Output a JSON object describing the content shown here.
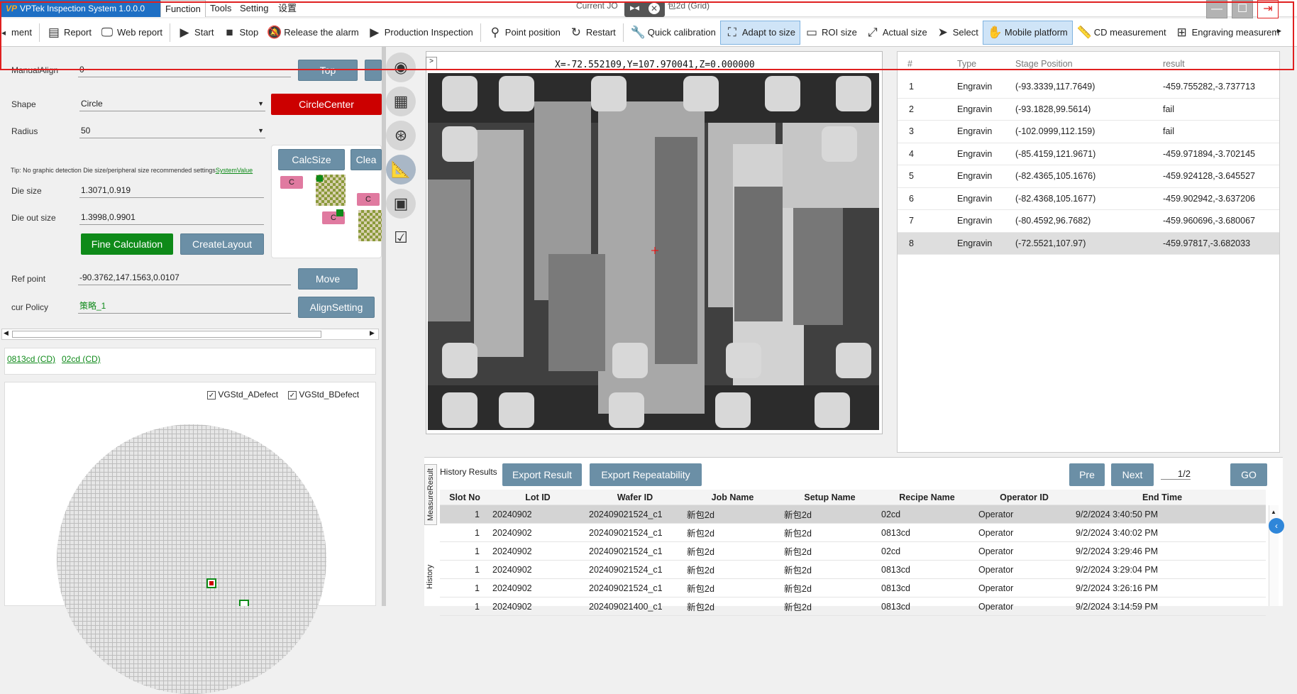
{
  "title_bar": {
    "app_title": "VPTek Inspection System 1.0.0.0",
    "logo": "VP",
    "menus": [
      "Function",
      "Tools",
      "Setting",
      "设置"
    ],
    "center_text_left": "Current JO",
    "center_text_right": "包2d (Grid)"
  },
  "toolbar": {
    "items": [
      {
        "label": "ment",
        "icon": "partial-icon"
      },
      {
        "label": "Report",
        "icon": "report-icon"
      },
      {
        "label": "Web report",
        "icon": "web-report-icon"
      },
      {
        "label": "Start",
        "icon": "play-icon"
      },
      {
        "label": "Stop",
        "icon": "stop-icon"
      },
      {
        "label": "Release the alarm",
        "icon": "bell-off-icon"
      },
      {
        "label": "Production Inspection",
        "icon": "play-outline-icon"
      },
      {
        "label": "Point position",
        "icon": "location-pin-icon"
      },
      {
        "label": "Restart",
        "icon": "restart-icon"
      },
      {
        "label": "Quick calibration",
        "icon": "wrench-icon"
      },
      {
        "label": "Adapt to size",
        "icon": "fit-size-icon"
      },
      {
        "label": "ROI size",
        "icon": "roi-icon"
      },
      {
        "label": "Actual size",
        "icon": "actual-size-icon"
      },
      {
        "label": "Select",
        "icon": "cursor-icon"
      },
      {
        "label": "Mobile platform",
        "icon": "hand-icon"
      },
      {
        "label": "CD measurement",
        "icon": "ruler-icon"
      },
      {
        "label": "Engraving measurem",
        "icon": "plus-box-icon"
      }
    ]
  },
  "left": {
    "manual_align_label": "ManualAlign",
    "manual_align_value": "0",
    "top_button": "Top",
    "shape_label": "Shape",
    "shape_value": "Circle",
    "circle_center_button": "CircleCenter",
    "radius_label": "Radius",
    "radius_value": "50",
    "calc_size_button": "CalcSize",
    "clear_button": "Clea",
    "tip_text": "Tip: No graphic detection Die size/peripheral size recommended settings",
    "tip_link": "SystemValue",
    "die_size_label": "Die size",
    "die_size_value": "1.3071,0.919",
    "die_out_size_label": "Die out size",
    "die_out_size_value": "1.3998,0.9901",
    "chip_label": "C",
    "fine_calc_button": "Fine Calculation",
    "create_layout_button": "CreateLayout",
    "ref_point_label": "Ref point",
    "ref_point_value": "-90.3762,147.1563,0.0107",
    "move_button": "Move",
    "cur_policy_label": "cur Policy",
    "cur_policy_value": "策略_1",
    "align_setting_button": "AlignSetting",
    "recipe_links": [
      "0813cd (CD)",
      "02cd (CD)"
    ],
    "defect_checks": [
      {
        "label": "VGStd_ADefect",
        "checked": true
      },
      {
        "label": "VGStd_BDefect",
        "checked": true
      }
    ]
  },
  "viewer": {
    "expand": ">",
    "coords": "X=-72.552109,Y=107.970041,Z=0.000000"
  },
  "results": {
    "columns": [
      "#",
      "Type",
      "Stage Position",
      "result"
    ],
    "rows": [
      [
        "1",
        "Engravin",
        "(-93.3339,117.7649)",
        "-459.755282,-3.737713"
      ],
      [
        "2",
        "Engravin",
        "(-93.1828,99.5614)",
        "fail"
      ],
      [
        "3",
        "Engravin",
        "(-102.0999,112.159)",
        "fail"
      ],
      [
        "4",
        "Engravin",
        "(-85.4159,121.9671)",
        "-459.971894,-3.702145"
      ],
      [
        "5",
        "Engravin",
        "(-82.4365,105.1676)",
        "-459.924128,-3.645527"
      ],
      [
        "6",
        "Engravin",
        "(-82.4368,105.1677)",
        "-459.902942,-3.637206"
      ],
      [
        "7",
        "Engravin",
        "(-80.4592,96.7682)",
        "-459.960696,-3.680067"
      ],
      [
        "8",
        "Engravin",
        "(-72.5521,107.97)",
        "-459.97817,-3.682033"
      ]
    ],
    "selected_row": 8
  },
  "history": {
    "title": "History Results",
    "export_result": "Export Result",
    "export_repeatability": "Export Repeatability",
    "pre": "Pre",
    "next": "Next",
    "page": "1/2",
    "go": "GO",
    "tabs": [
      "MeasureResult",
      "History"
    ],
    "columns": [
      "Slot No",
      "Lot ID",
      "Wafer ID",
      "Job Name",
      "Setup Name",
      "Recipe Name",
      "Operator ID",
      "End Time"
    ],
    "rows": [
      [
        "1",
        "20240902",
        "202409021524_c1",
        "新包2d",
        "新包2d",
        "02cd",
        "Operator",
        "9/2/2024 3:40:50 PM"
      ],
      [
        "1",
        "20240902",
        "202409021524_c1",
        "新包2d",
        "新包2d",
        "0813cd",
        "Operator",
        "9/2/2024 3:40:02 PM"
      ],
      [
        "1",
        "20240902",
        "202409021524_c1",
        "新包2d",
        "新包2d",
        "02cd",
        "Operator",
        "9/2/2024 3:29:46 PM"
      ],
      [
        "1",
        "20240902",
        "202409021524_c1",
        "新包2d",
        "新包2d",
        "0813cd",
        "Operator",
        "9/2/2024 3:29:04 PM"
      ],
      [
        "1",
        "20240902",
        "202409021524_c1",
        "新包2d",
        "新包2d",
        "0813cd",
        "Operator",
        "9/2/2024 3:26:16 PM"
      ],
      [
        "1",
        "20240902",
        "202409021400_c1",
        "新包2d",
        "新包2d",
        "0813cd",
        "Operator",
        "9/2/2024 3:14:59 PM"
      ]
    ],
    "selected_row": 1
  },
  "colors": {
    "accent_blue": "#1e6fc4",
    "button_blue": "#6b8fa6",
    "green": "#0e8a19",
    "red": "#cc0000",
    "highlight_frame": "#e02020"
  }
}
